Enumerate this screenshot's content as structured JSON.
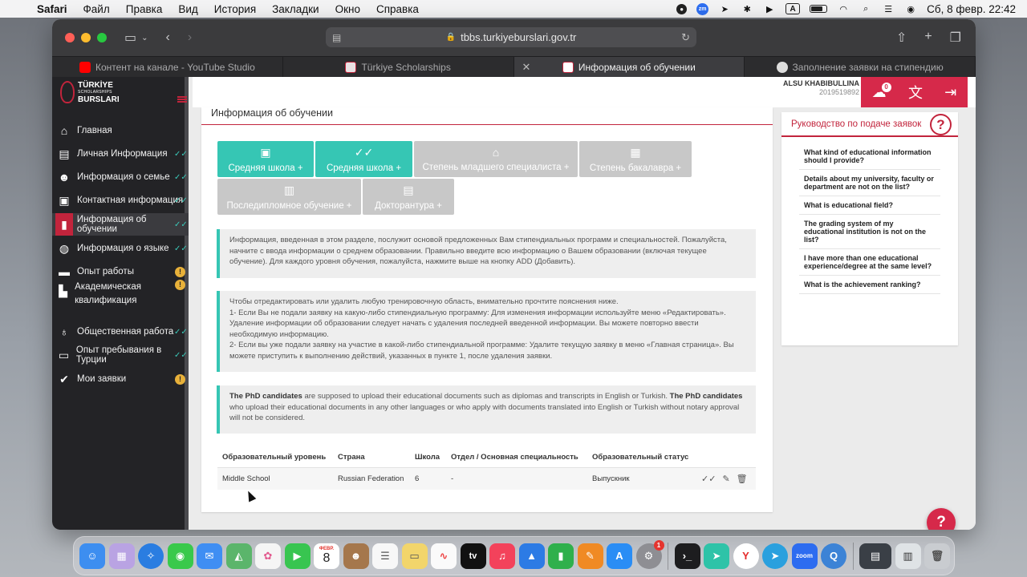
{
  "menubar": {
    "app": "Safari",
    "items": [
      "Файл",
      "Правка",
      "Вид",
      "История",
      "Закладки",
      "Окно",
      "Справка"
    ],
    "status_a": "A",
    "clock": "Сб, 8 февр.  22:42"
  },
  "browser": {
    "url": "tbbs.turkiyeburslari.gov.tr",
    "tabs": [
      {
        "label": "Контент на канале - YouTube Studio",
        "favicon_color": "#ff0000"
      },
      {
        "label": "Türkiye Scholarships",
        "favicon_color": "#e9e1e3"
      },
      {
        "label": "Информация об обучении",
        "favicon_color": "#ffffff"
      },
      {
        "label": "Заполнение заявки на стипендию",
        "favicon_color": "#dddddd"
      }
    ]
  },
  "brand": {
    "line1": "TÜRKİYE",
    "line2": "SCHOLARSHIPS",
    "line3": "BURSLARI"
  },
  "sidebar": {
    "items": [
      {
        "label": "Главная",
        "icon": "home-icon",
        "status": "none"
      },
      {
        "label": "Личная Информация",
        "icon": "id-card-icon",
        "status": "done"
      },
      {
        "label": "Информация о семье",
        "icon": "family-icon",
        "status": "done"
      },
      {
        "label": "Контактная информация",
        "icon": "contact-card-icon",
        "status": "done"
      },
      {
        "label": "Информация об обучении",
        "icon": "book-icon",
        "status": "done"
      },
      {
        "label": "Информация о языке",
        "icon": "globe-icon",
        "status": "done"
      },
      {
        "label": "Опыт работы",
        "icon": "briefcase-icon",
        "status": "warn"
      },
      {
        "label": "Академическая квалификация",
        "icon": "certificate-icon",
        "status": "warn"
      },
      {
        "label": "Общественная работа",
        "icon": "medal-icon",
        "status": "done"
      },
      {
        "label": "Опыт пребывания в Турции",
        "icon": "chat-icon",
        "status": "done"
      },
      {
        "label": "Мои заявки",
        "icon": "shield-check-icon",
        "status": "warn"
      }
    ],
    "warn_symbol": "!"
  },
  "header": {
    "user_name": "ALSU KHABIBULLINA",
    "user_id": "2019519892",
    "cloud_badge": "0"
  },
  "main": {
    "title": "Информация об обучении",
    "buttons": [
      {
        "label": "Средняя школа +",
        "state": "active"
      },
      {
        "label": "Средняя школа +",
        "state": "active"
      },
      {
        "label": "Степень младшего специалиста +",
        "state": "inactive"
      },
      {
        "label": "Степень бакалавра +",
        "state": "inactive"
      },
      {
        "label": "Последипломное обучение +",
        "state": "inactive"
      },
      {
        "label": "Докторантура +",
        "state": "inactive"
      }
    ],
    "info1": "Информация, введенная в этом разделе, послужит основой предложенных Вам стипендиальных программ и специальностей. Пожалуйста, начните с ввода информации о среднем образовании. Правильно введите всю информацию о Вашем образовании (включая текущее обучение). Для каждого уровня обучения, пожалуйста, нажмите выше на кнопку ADD (Добавить).",
    "info2_line1": "Чтобы отредактировать или удалить любую тренировочную область, внимательно прочтите пояснения ниже.",
    "info2_line2": "1- Если Вы не подали заявку на какую-либо стипендиальную программу: Для изменения информации используйте меню «Редактировать». Удаление информации об образовании следует начать с удаления последней введенной информации. Вы можете повторно ввести необходимую информацию.",
    "info2_line3": "2- Если вы уже подали заявку на участие в какой-либо стипендиальной программе: Удалите текущую заявку в меню «Главная страница». Вы можете приступить к выполнению действий, указанных в пункте 1, после удаления заявки.",
    "info3_bold1": "The PhD candidates",
    "info3_text1": " are supposed to upload their educational documents such as diplomas and transcripts in English or Turkish. ",
    "info3_bold2": "The PhD candidates",
    "info3_text2": " who upload their educational documents in any other languages or who apply with documents translated into English or Turkish without notary approval will not be considered.",
    "table": {
      "headers": [
        "Образовательный уровень",
        "Страна",
        "Школа",
        "Отдел / Основная специальность",
        "Образовательный статус"
      ],
      "rows": [
        {
          "level": "Middle School",
          "country": "Russian Federation",
          "school": "6",
          "department": "-",
          "status": "Выпускник"
        }
      ]
    }
  },
  "guide": {
    "title": "Руководство по подаче заявок",
    "qmark": "?",
    "items": [
      "What kind of educational information should I provide?",
      "Details about my university, faculty or department are not on the list?",
      "What is educational field?",
      "The grading system of my educational institution is not on the list?",
      "I have more than one educational experience/degree at the same level?",
      "What is the achievement ranking?"
    ]
  },
  "help_fab": "?",
  "dock": {
    "calendar_month": "ФЕВР.",
    "calendar_day": "8",
    "tv_label": "tv",
    "appstore_badge": "1",
    "zoom_label": "zoom"
  }
}
